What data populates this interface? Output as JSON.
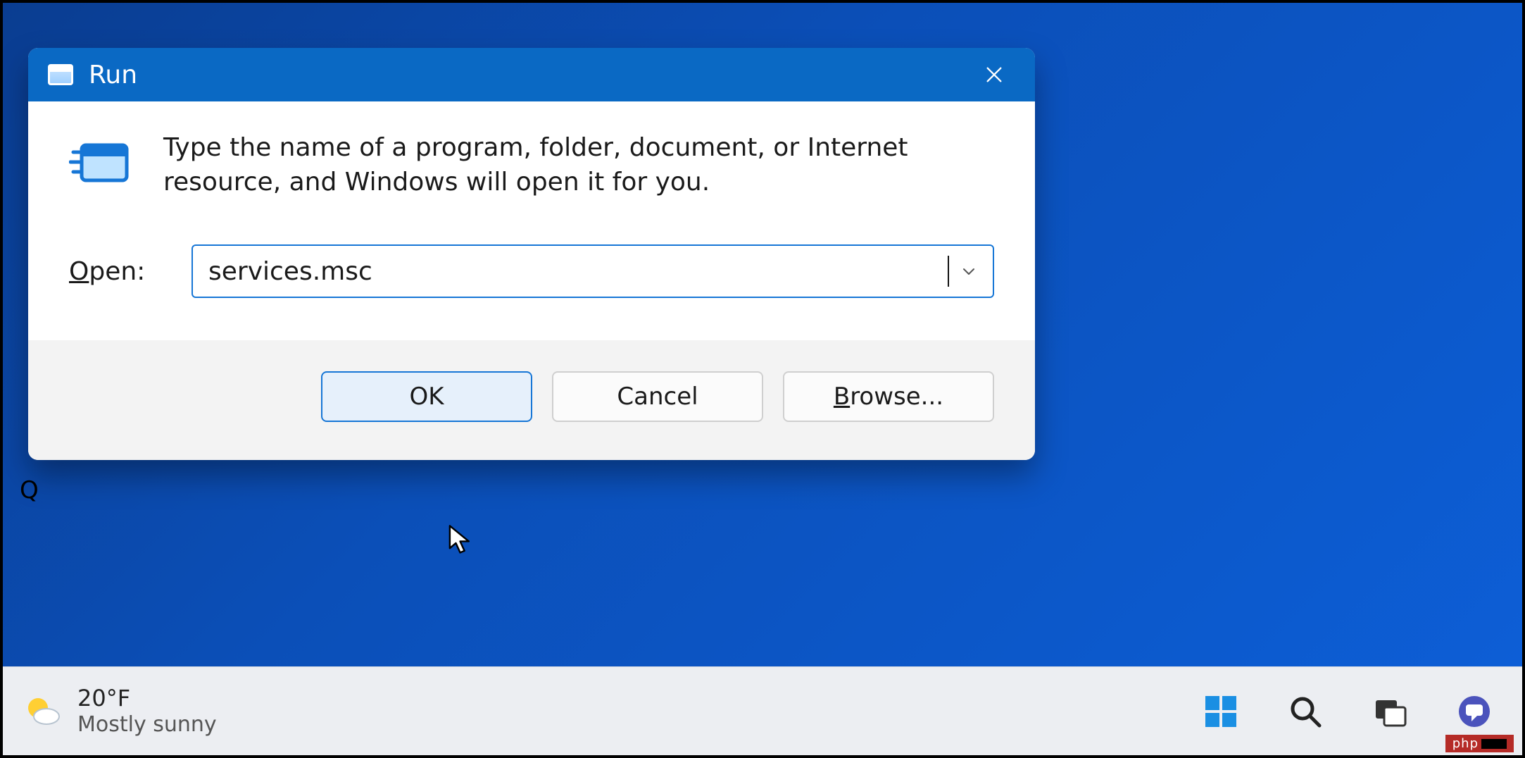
{
  "desktop": {
    "quick_label_fragment": "Q"
  },
  "dialog": {
    "title": "Run",
    "description": "Type the name of a program, folder, document, or Internet resource, and Windows will open it for you.",
    "open_label_pre": "O",
    "open_label_post": "pen:",
    "input_value": "services.msc",
    "buttons": {
      "ok": "OK",
      "cancel": "Cancel",
      "browse_pre": "B",
      "browse_post": "rowse..."
    }
  },
  "taskbar": {
    "weather": {
      "temp": "20°F",
      "condition": "Mostly sunny"
    }
  },
  "watermark": "php"
}
